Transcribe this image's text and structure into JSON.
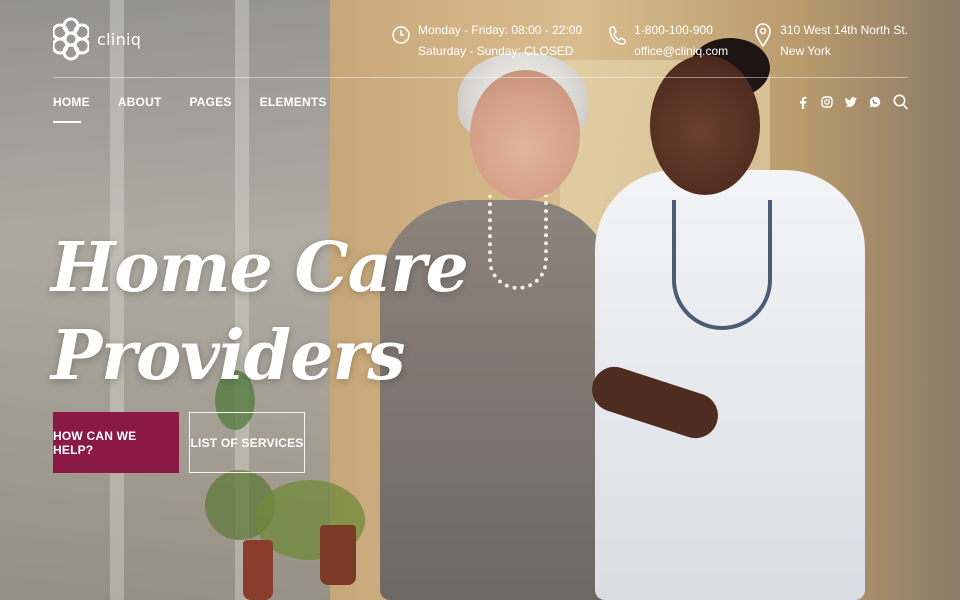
{
  "brand": {
    "name": "cliniq"
  },
  "contact": {
    "hours": {
      "line1": "Monday - Friday: 08:00 - 22:00",
      "line2": "Saturday - Sunday: CLOSED",
      "icon": "clock-icon"
    },
    "phone": {
      "line1": "1-800-100-900",
      "line2": "office@cliniq.com",
      "icon": "phone-icon"
    },
    "address": {
      "line1": "310 West 14th North St.",
      "line2": "New York",
      "icon": "map-pin-icon"
    }
  },
  "nav": {
    "items": [
      {
        "label": "HOME",
        "active": true
      },
      {
        "label": "ABOUT",
        "active": false
      },
      {
        "label": "PAGES",
        "active": false
      },
      {
        "label": "ELEMENTS",
        "active": false
      }
    ]
  },
  "social": [
    "facebook-icon",
    "instagram-icon",
    "twitter-icon",
    "whatsapp-icon",
    "search-icon"
  ],
  "hero": {
    "title_line1": "Home Care",
    "title_line2": "Providers",
    "primary_button": "HOW CAN WE HELP?",
    "secondary_button": "LIST OF SERVICES"
  },
  "colors": {
    "accent": "#8a1a45",
    "text": "#ffffff"
  }
}
